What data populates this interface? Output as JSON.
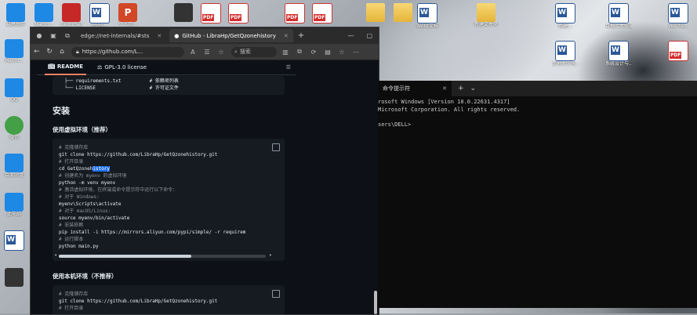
{
  "desktop": {
    "icons_top": [
      {
        "label": "悬思助手",
        "icon": "app-icon"
      },
      {
        "label": "Macro...",
        "icon": "app-icon"
      },
      {
        "label": "Launcher",
        "icon": "game-icon"
      },
      {
        "label": "2025...",
        "icon": "word-icon"
      },
      {
        "label": "个人简...",
        "icon": "ppt-icon"
      },
      {
        "label": "",
        "icon": "dark-app-icon"
      },
      {
        "label": "",
        "icon": "pdf-icon"
      },
      {
        "label": "",
        "icon": "pdf-icon"
      },
      {
        "label": "",
        "icon": "pdf-icon"
      },
      {
        "label": "",
        "icon": "pdf-icon"
      }
    ],
    "icons_top_right": [
      {
        "label": "",
        "icon": "folder-icon"
      },
      {
        "label": "",
        "icon": "folder-icon"
      },
      {
        "label": "Word文档",
        "icon": "word-icon"
      },
      {
        "label": "新建文件夹",
        "icon": "folder-icon"
      },
      {
        "label": "新建...",
        "icon": "word-icon"
      },
      {
        "label": "数据库大作业...docx",
        "icon": "word-icon"
      },
      {
        "label": "vue-hs...",
        "icon": "word-icon"
      }
    ],
    "icons_right2": [
      {
        "label": "新地大学东...学院实验报告",
        "icon": "word-icon"
      },
      {
        "label": "系统设计与...设计报告",
        "icon": "word-icon"
      },
      {
        "label": "",
        "icon": "pdf-icon"
      }
    ],
    "icons_left": [
      {
        "label": "Macro...",
        "icon": "app-icon"
      },
      {
        "label": "QQ",
        "icon": "qq-icon"
      },
      {
        "label": "微信",
        "icon": "wechat-icon"
      },
      {
        "label": "百度网盘",
        "icon": "cloud-icon"
      },
      {
        "label": "此电脑",
        "icon": "computer-icon"
      },
      {
        "label": "",
        "icon": "file-icon"
      },
      {
        "label": "",
        "icon": "image-icon"
      }
    ]
  },
  "browser": {
    "tabs": [
      {
        "label": "edge://net-internals/#sts"
      },
      {
        "label": "GitHub - LibraHp/GetQzonehistory"
      }
    ],
    "url": "https://github.com/L...",
    "search_label": "搜索",
    "readme_nav": {
      "readme": "README",
      "license": "GPL-3.0 license"
    },
    "tree_block": [
      "  ├── requirements.txt          # 依赖项列表",
      "  └── LICENSE                   # 许可证文件"
    ],
    "heading_install": "安装",
    "heading_venv": "使用虚拟环境（推荐）",
    "venv_code": [
      {
        "t": "# 克隆储存库",
        "c": true
      },
      {
        "t": "git clone https://github.com/LibraHp/GetQzonehistory.git",
        "c": false
      },
      {
        "t": "# 打开目录",
        "c": true
      },
      {
        "t": "cd GetQzoneh",
        "c": false,
        "sel": "istory"
      },
      {
        "t": "# 创建名为 myenv 的虚拟环境",
        "c": true
      },
      {
        "t": "python -m venv myenv",
        "c": false
      },
      {
        "t": "# 激活虚拟环境，在终端或命令提示符中运行以下命令：",
        "c": true
      },
      {
        "t": "# 对于 Windows:",
        "c": true
      },
      {
        "t": "myenv\\Scripts\\activate",
        "c": false
      },
      {
        "t": "# 对于 macOS/Linux:",
        "c": true
      },
      {
        "t": "source myenv/bin/activate",
        "c": false
      },
      {
        "t": "# 安装依赖",
        "c": true
      },
      {
        "t": "pip install -i https://mirrors.aliyun.com/pypi/simple/ -r requirem",
        "c": false
      },
      {
        "t": "# 运行脚本",
        "c": true
      },
      {
        "t": "python main.py",
        "c": false
      }
    ],
    "heading_local": "使用本机环境（不推荐）",
    "local_code": [
      {
        "t": "# 克隆储存库",
        "c": true
      },
      {
        "t": "git clone https://github.com/LibraHp/GetQzonehistory.git",
        "c": false
      },
      {
        "t": "# 打开目录",
        "c": true
      }
    ]
  },
  "terminal": {
    "tab_title": "命令提示符",
    "lines": [
      "rosoft Windows [Version 10.0.22631.4317]",
      "Microsoft Corporation. All rights reserved.",
      "",
      "sers\\DELL>"
    ]
  }
}
